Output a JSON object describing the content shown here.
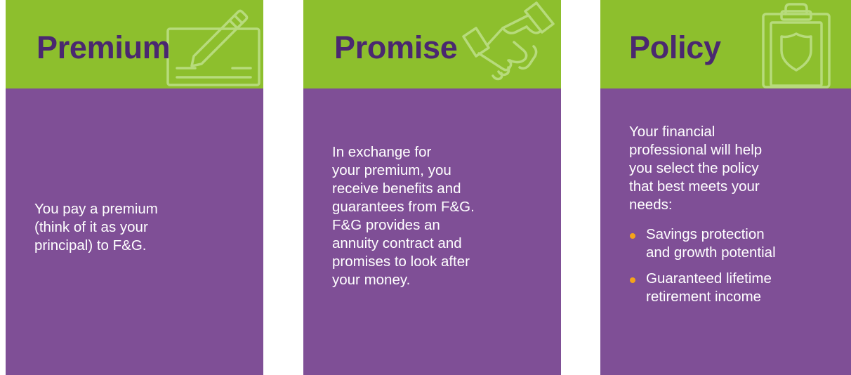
{
  "colors": {
    "header_green": "#8dbf2d",
    "card_purple": "#7f4f96",
    "title_purple": "#4a2870",
    "icon_line": "#b7db7c",
    "bullet_orange": "#f5a31a",
    "body_text": "#ffffff"
  },
  "cards": [
    {
      "title": "Premium",
      "icon": "check-pen-icon",
      "lines": [
        "You pay a premium",
        "(think of it as your",
        "principal) to F&G."
      ]
    },
    {
      "title": "Promise",
      "icon": "handshake-icon",
      "lines": [
        "In exchange for",
        "your premium, you",
        "receive benefits and",
        "guarantees from F&G.",
        "F&G provides an",
        "annuity contract and",
        "promises to look after",
        "your money."
      ]
    },
    {
      "title": "Policy",
      "icon": "clipboard-shield-icon",
      "lines": [
        "Your financial",
        "professional will help",
        "you select the policy",
        "that best meets your",
        "needs:"
      ],
      "bullets": [
        {
          "lines": [
            "Savings protection",
            "and growth potential"
          ]
        },
        {
          "lines": [
            "Guaranteed lifetime",
            "retirement income"
          ]
        }
      ]
    }
  ]
}
